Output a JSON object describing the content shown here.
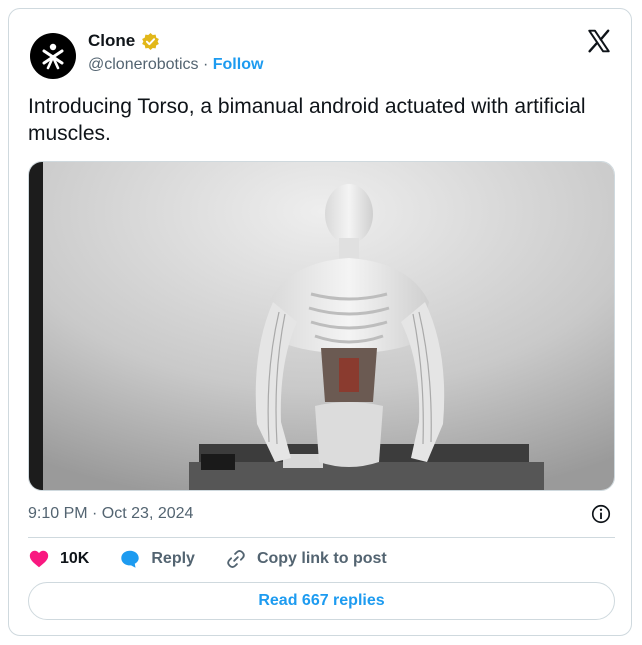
{
  "author": {
    "name": "Clone",
    "handle": "@clonerobotics",
    "separator": "·",
    "follow_label": "Follow"
  },
  "tweet": {
    "text": "Introducing Torso, a bimanual android actuated with artificial muscles.",
    "timestamp": "9:10 PM · Oct 23, 2024"
  },
  "actions": {
    "like_count": "10K",
    "reply_label": "Reply",
    "copy_link_label": "Copy link to post"
  },
  "read_replies_label": "Read 667 replies",
  "icons": {
    "verified": "verified-badge-icon",
    "platform": "x-logo-icon",
    "info": "info-icon",
    "like": "heart-icon",
    "reply": "speech-bubble-icon",
    "link": "link-icon"
  },
  "colors": {
    "accent": "#1d9bf0",
    "like": "#f91880",
    "verified": "#e2b719",
    "muted": "#536471",
    "border": "#cfd9de"
  }
}
